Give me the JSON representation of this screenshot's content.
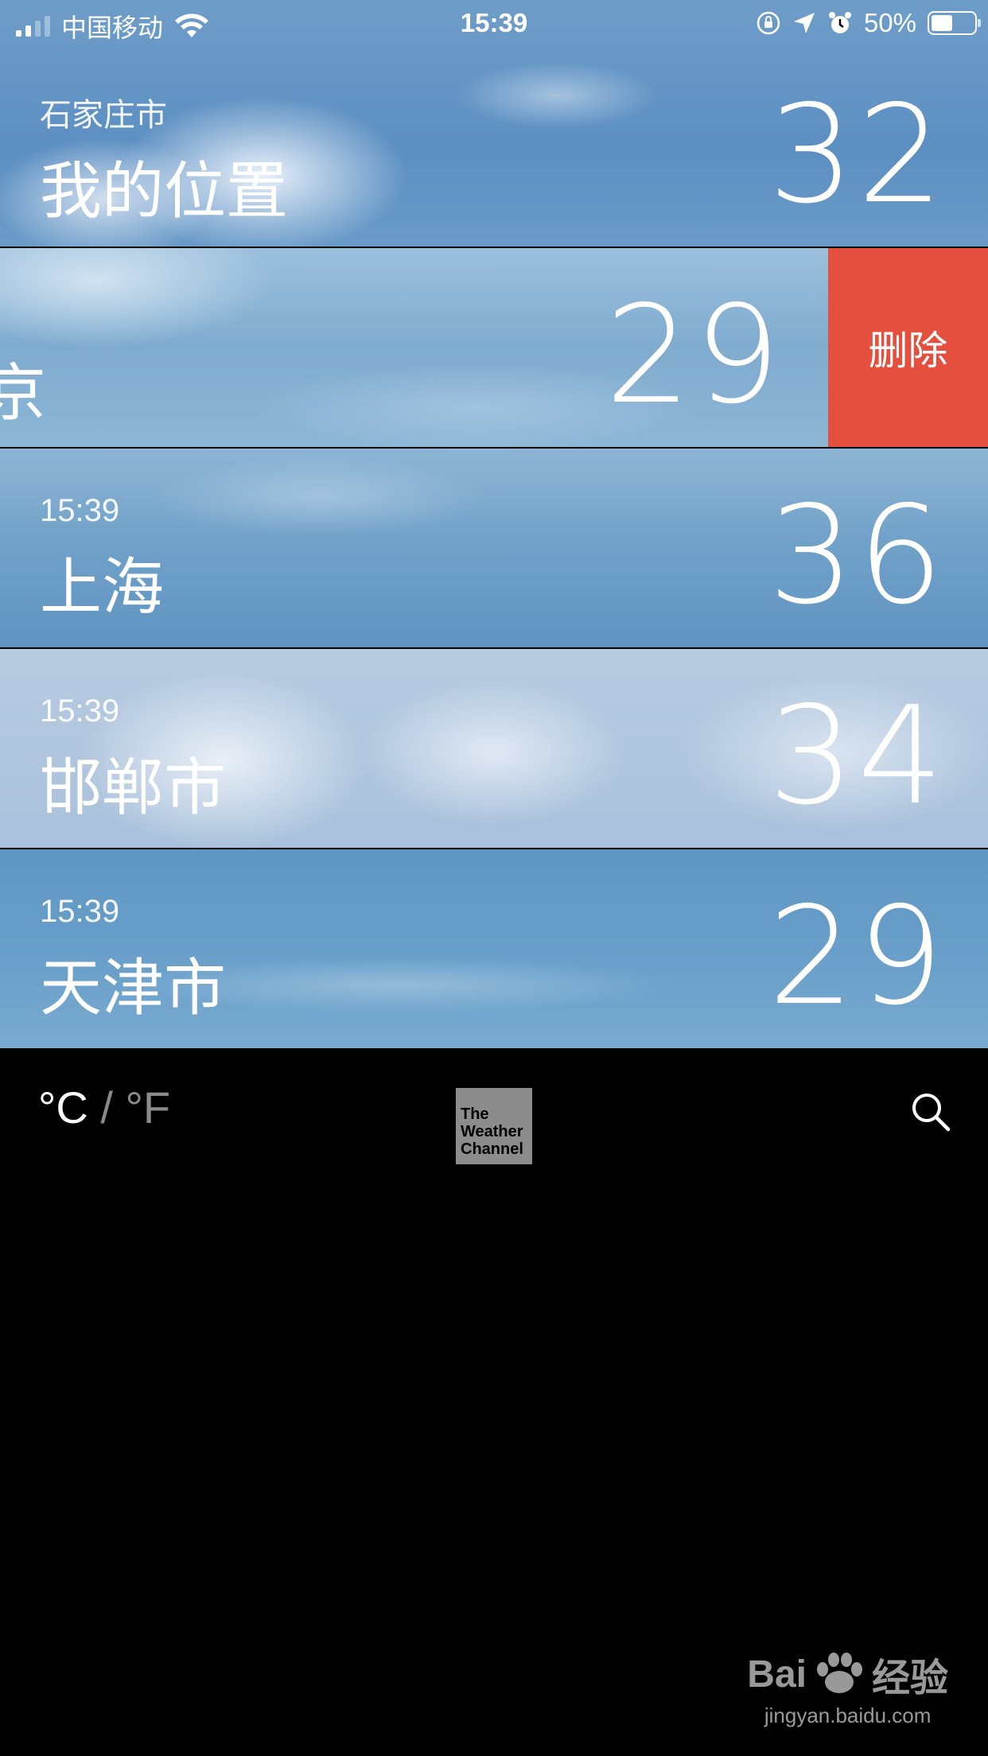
{
  "status_bar": {
    "carrier": "中国移动",
    "time": "15:39",
    "battery_percent": "50%",
    "battery_level": 0.5,
    "icons": [
      "signal-icon",
      "wifi-icon",
      "orientation-lock-icon",
      "location-arrow-icon",
      "alarm-icon",
      "battery-icon"
    ]
  },
  "cities": [
    {
      "subtitle": "石家庄市",
      "name": "我的位置",
      "temp": "32"
    },
    {
      "subtitle": "",
      "name": "京",
      "temp": "29",
      "action": "删除"
    },
    {
      "subtitle": "15:39",
      "name": "上海",
      "temp": "36"
    },
    {
      "subtitle": "15:39",
      "name": "邯郸市",
      "temp": "34"
    },
    {
      "subtitle": "15:39",
      "name": "天津市",
      "temp": "29"
    }
  ],
  "toolbar": {
    "unit_c": "°C",
    "unit_sep": "/",
    "unit_f": "°F",
    "logo_text": [
      "The",
      "Weather",
      "Channel"
    ],
    "search_icon": "search-icon"
  },
  "watermark": {
    "brand": "Bai",
    "brand_suffix": "经验",
    "url": "jingyan.baidu.com"
  },
  "colors": {
    "delete": "#e5503e",
    "background": "#000000",
    "sky": "#6a9bc8"
  }
}
